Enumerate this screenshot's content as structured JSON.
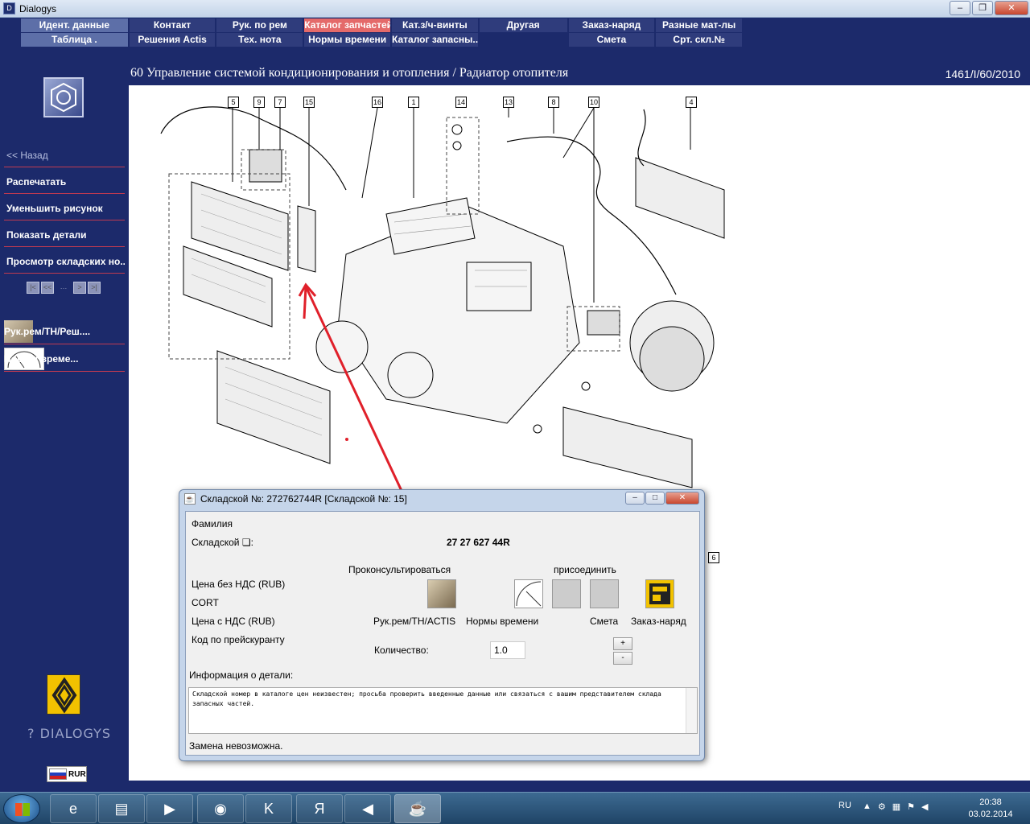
{
  "window": {
    "title": "Dialogys"
  },
  "topmenu": {
    "row1": [
      "Идент. данные",
      "Контакт",
      "Рук. по рем",
      "Каталог запчастей",
      "Кат.з/ч-винты",
      "Другая",
      "Заказ-наряд",
      "Разные мат-лы"
    ],
    "row2": [
      "Таблица .",
      "Решения Actis",
      "Тех. нота",
      "Нормы времени",
      "Каталог запасны...",
      "",
      "Смета",
      "Срт. скл.№"
    ]
  },
  "sidebar": {
    "back": "<< Назад",
    "items": [
      "Распечатать",
      "Уменьшить рисунок",
      "Показать детали",
      "Просмотр складских но..."
    ],
    "tools": [
      "Рук.рем/ТН/Реш....",
      "Нормы време..."
    ],
    "brand": "DIALOGYS",
    "currency": "RUR"
  },
  "page": {
    "heading": "60 Управление системой кондиционирования и отопления / Радиатор отопителя",
    "ref": "1461/I/60/2010"
  },
  "callouts": [
    "5",
    "9",
    "7",
    "15",
    "16",
    "1",
    "14",
    "13",
    "8",
    "10",
    "4",
    "6"
  ],
  "dialog": {
    "title": "Складской №: 272762744R [Складской №: 15]",
    "family_label": "Фамилия",
    "part_label": "Складской ❏:",
    "part_value": "27 27 627 44R",
    "consult_label": "Проконсультироваться",
    "attach_label": "присоединить",
    "price_no_vat": "Цена без НДС (RUB)",
    "cort": "CORT",
    "price_vat": "Цена с НДС (RUB)",
    "price_code": "Код по прейскуранту",
    "btn_manual": "Рук.рем/ТН/ACTIS",
    "btn_norms": "Нормы времени",
    "btn_estimate": "Смета",
    "btn_order": "Заказ-наряд",
    "qty_label": "Количество:",
    "qty_value": "1.0",
    "plus": "+",
    "minus": "-",
    "info_label": "Информация о детали:",
    "info_text": "Складской номер в каталоге цен неизвестен; просьба проверить введенные данные или связаться с вашим представителем склада запасных частей.",
    "status": "Замена невозможна."
  },
  "taskbar": {
    "lang": "RU",
    "time": "20:38",
    "date": "03.02.2014"
  }
}
